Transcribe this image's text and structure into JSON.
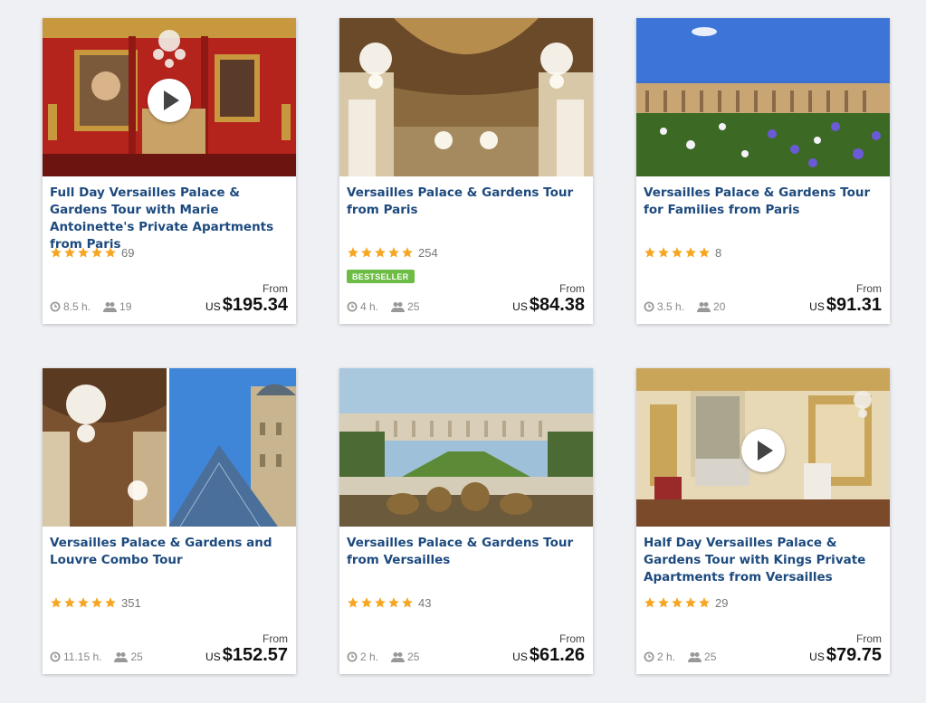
{
  "tours": [
    {
      "title": "Full Day Versailles Palace & Gardens Tour with Marie Antoinette's Private Apartments from Paris",
      "rating_count": "69",
      "duration": "8.5 h.",
      "group_size": "19",
      "from_label": "From",
      "currency": "US",
      "price": "$195.34",
      "badge": "",
      "has_video": true,
      "image": "red bedroom with chandelier and portraits",
      "rating": 5
    },
    {
      "title": "Versailles Palace & Gardens Tour from Paris",
      "rating_count": "254",
      "duration": "4 h.",
      "group_size": "25",
      "from_label": "From",
      "currency": "US",
      "price": "$84.38",
      "badge": "BESTSELLER",
      "has_video": false,
      "image": "hall of mirrors with chandeliers",
      "rating": 5
    },
    {
      "title": "Versailles Palace & Gardens Tour for Families from Paris",
      "rating_count": "8",
      "duration": "3.5 h.",
      "group_size": "20",
      "from_label": "From",
      "currency": "US",
      "price": "$91.31",
      "badge": "",
      "has_video": false,
      "image": "palace facade behind flower garden",
      "rating": 5
    },
    {
      "title": "Versailles Palace & Gardens and Louvre Combo Tour",
      "rating_count": "351",
      "duration": "11.15 h.",
      "group_size": "25",
      "from_label": "From",
      "currency": "US",
      "price": "$152.57",
      "badge": "",
      "has_video": false,
      "image": "chandeliers and louvre pyramid",
      "rating": 5
    },
    {
      "title": "Versailles Palace & Gardens Tour from Versailles",
      "rating_count": "43",
      "duration": "2 h.",
      "group_size": "25",
      "from_label": "From",
      "currency": "US",
      "price": "$61.26",
      "badge": "",
      "has_video": false,
      "image": "gardens with apollo fountain",
      "rating": 5
    },
    {
      "title": "Half Day Versailles Palace & Gardens Tour with Kings Private Apartments from Versailles",
      "rating_count": "29",
      "duration": "2 h.",
      "group_size": "25",
      "from_label": "From",
      "currency": "US",
      "price": "$79.75",
      "badge": "",
      "has_video": true,
      "image": "gilded royal apartment room",
      "rating": 5
    }
  ],
  "colors": {
    "title": "#1d4a7e",
    "star": "#f5a623",
    "badge": "#6cbc45",
    "background": "#eef0f4"
  },
  "icons": {
    "play": "play-icon",
    "star": "star-icon",
    "duration": "clock-icon",
    "group": "group-icon"
  }
}
